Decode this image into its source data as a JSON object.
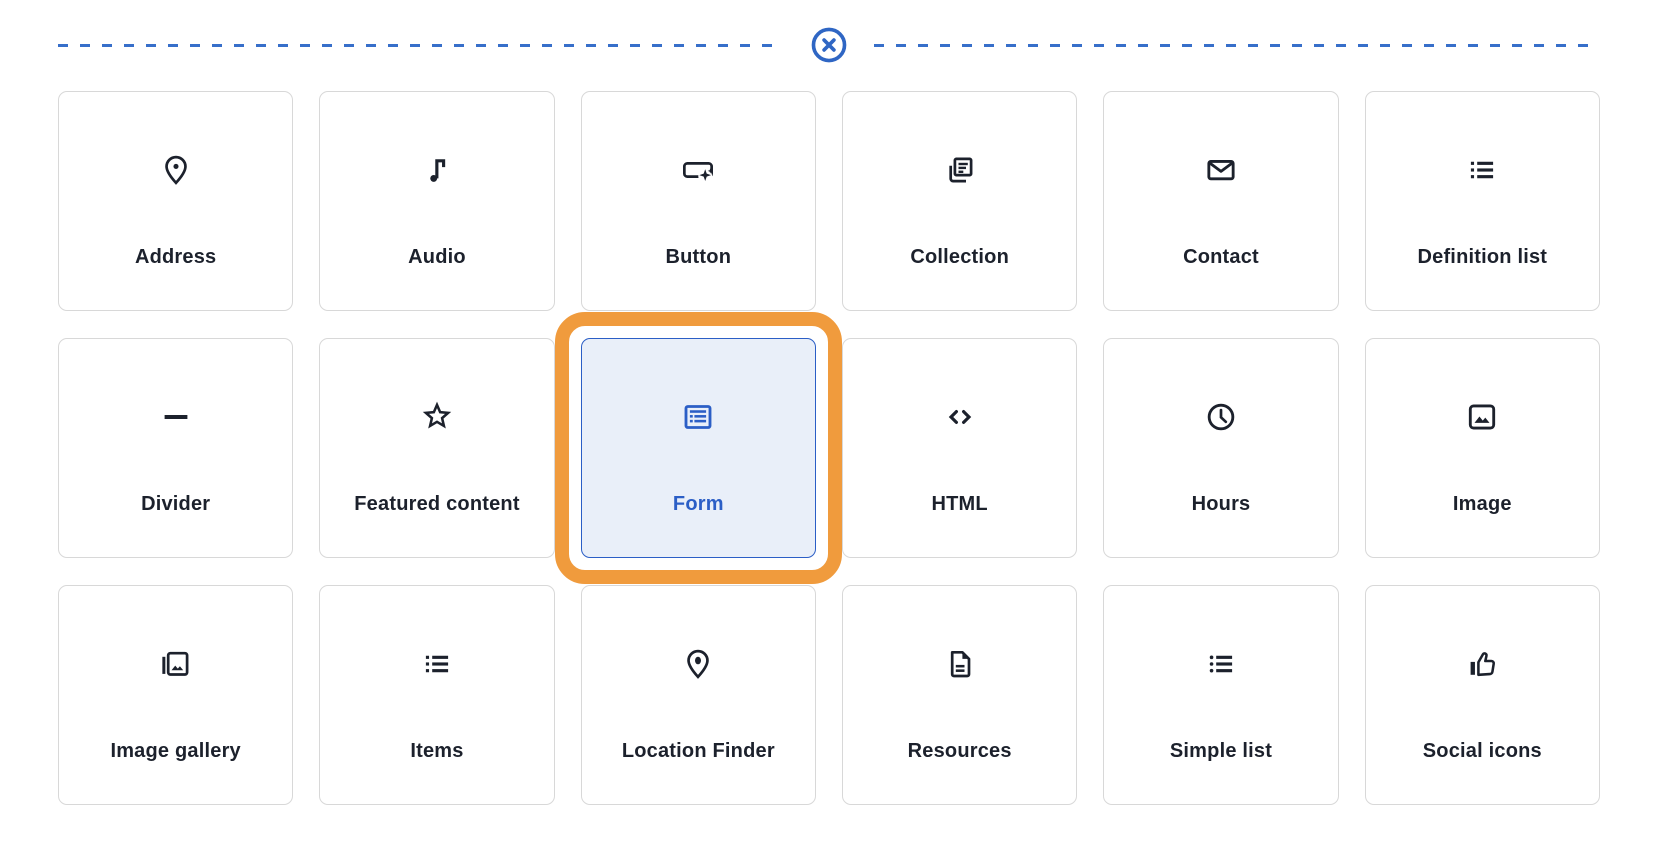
{
  "palette": {
    "icon_dark": "#1c212c",
    "card_border": "#d8d8d8",
    "selected_blue": "#2b5ec6",
    "selected_fill": "#e9eff9",
    "highlight_orange": "#f09b3d",
    "line_blue": "#376fca"
  },
  "separator": {
    "close_icon": "circle-x"
  },
  "blocks": [
    {
      "label": "Address",
      "icon": "map-pin",
      "selected": false
    },
    {
      "label": "Audio",
      "icon": "music-note",
      "selected": false
    },
    {
      "label": "Button",
      "icon": "button-sparkle",
      "selected": false
    },
    {
      "label": "Collection",
      "icon": "collection-pages",
      "selected": false
    },
    {
      "label": "Contact",
      "icon": "envelope",
      "selected": false
    },
    {
      "label": "Definition list",
      "icon": "list-bullets-square",
      "selected": false
    },
    {
      "label": "Divider",
      "icon": "minus",
      "selected": false
    },
    {
      "label": "Featured content",
      "icon": "star",
      "selected": false
    },
    {
      "label": "Form",
      "icon": "form-table",
      "selected": true
    },
    {
      "label": "HTML",
      "icon": "code-brackets",
      "selected": false
    },
    {
      "label": "Hours",
      "icon": "clock",
      "selected": false
    },
    {
      "label": "Image",
      "icon": "image-photo",
      "selected": false
    },
    {
      "label": "Image gallery",
      "icon": "image-stack",
      "selected": false
    },
    {
      "label": "Items",
      "icon": "list-bullets-square",
      "selected": false
    },
    {
      "label": "Location Finder",
      "icon": "map-pin-filled",
      "selected": false
    },
    {
      "label": "Resources",
      "icon": "document-file",
      "selected": false
    },
    {
      "label": "Simple list",
      "icon": "list-bullets-round",
      "selected": false
    },
    {
      "label": "Social icons",
      "icon": "thumbs-up",
      "selected": false
    }
  ]
}
